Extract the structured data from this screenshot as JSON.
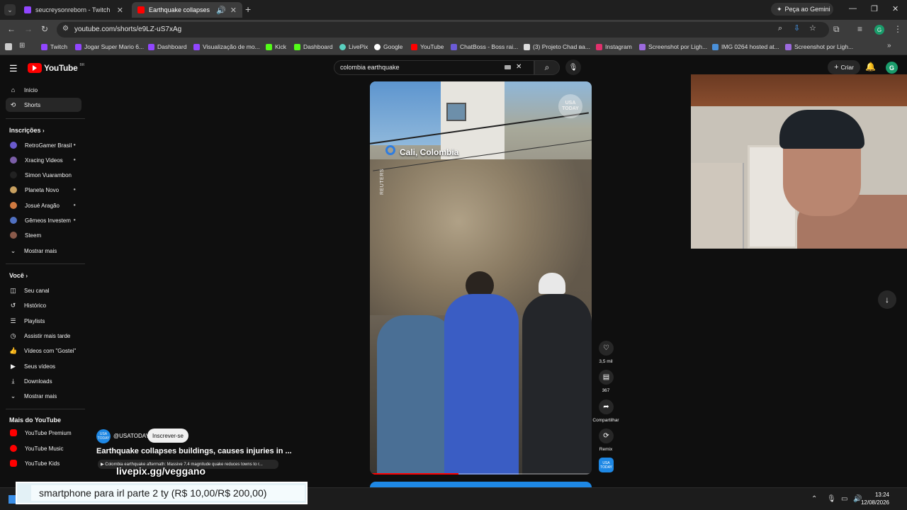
{
  "browser": {
    "tabs": [
      {
        "label": "seucreysonreborn - Twitch",
        "color": "#9146ff"
      },
      {
        "label": "Earthquake collapses buildi",
        "color": "#ff0000"
      }
    ],
    "gemini_label": "Peça ao Gemini",
    "url": "youtube.com/shorts/e9LZ-uS7xAg",
    "profile_initial": "G",
    "bookmarks": [
      {
        "label": "Twitch",
        "color": "#9146ff"
      },
      {
        "label": "Jogar Super Mario 6...",
        "color": "#9146ff"
      },
      {
        "label": "Dashboard",
        "color": "#9146ff"
      },
      {
        "label": "Visualização de mo...",
        "color": "#9146ff"
      },
      {
        "label": "Kick",
        "color": "#53fc18"
      },
      {
        "label": "Dashboard",
        "color": "#53fc18"
      },
      {
        "label": "LivePix",
        "color": "#5ad0c0"
      },
      {
        "label": "Google",
        "color": "#ffffff"
      },
      {
        "label": "YouTube",
        "color": "#ff0000"
      },
      {
        "label": "ChatBoss - Boss rai...",
        "color": "#6b5bd6"
      },
      {
        "label": "(3) Projeto Chad ва...",
        "color": "#dddddd"
      },
      {
        "label": "Instagram",
        "color": "#e1306c"
      },
      {
        "label": "Screenshot por Ligh...",
        "color": "#9c6ade"
      },
      {
        "label": "IMG 0264 hosted at...",
        "color": "#4a90d9"
      },
      {
        "label": "Screenshot por Ligh...",
        "color": "#9c6ade"
      }
    ]
  },
  "youtube": {
    "logo_text": "YouTube",
    "logo_region": "BR",
    "search_value": "colombia earthquake",
    "create_label": "Criar",
    "avatar_initial": "G",
    "sidebar": {
      "main": [
        {
          "label": "Início",
          "icon": "home-icon"
        },
        {
          "label": "Shorts",
          "icon": "shorts-icon"
        }
      ],
      "subscriptions_title": "Inscrições",
      "subscriptions": [
        {
          "label": "RetroGamer Brasil",
          "color": "#6a5acd"
        },
        {
          "label": "Xracing Videos",
          "color": "#7b5ea7"
        },
        {
          "label": "Simon Vuarambon",
          "color": "#222222"
        },
        {
          "label": "Planeta Novo",
          "color": "#c8a060"
        },
        {
          "label": "Josué Aragão",
          "color": "#d07a40"
        },
        {
          "label": "Gêmeos Investem",
          "color": "#5070c0"
        },
        {
          "label": "Steem",
          "color": "#8a5a4a"
        }
      ],
      "show_more": "Mostrar mais",
      "you_title": "Você",
      "you": [
        {
          "label": "Seu canal",
          "icon": "channel-icon"
        },
        {
          "label": "Histórico",
          "icon": "history-icon"
        },
        {
          "label": "Playlists",
          "icon": "playlists-icon"
        },
        {
          "label": "Assistir mais tarde",
          "icon": "watch-later-icon"
        },
        {
          "label": "Vídeos com \"Gostei\"",
          "icon": "like-icon"
        },
        {
          "label": "Seus vídeos",
          "icon": "your-videos-icon"
        },
        {
          "label": "Downloads",
          "icon": "download-icon"
        }
      ],
      "show_more_2": "Mostrar mais",
      "more_title": "Mais do YouTube",
      "more": [
        {
          "label": "YouTube Premium",
          "color": "#ff0000"
        },
        {
          "label": "YouTube Music",
          "color": "#ff0000"
        },
        {
          "label": "YouTube Kids",
          "color": "#ff0000"
        }
      ]
    },
    "short": {
      "location": "Cali, Colombia",
      "watermark": "USA TODAY",
      "credit": "REUTERS",
      "progress": 0.4,
      "likes": "3,5 mil",
      "comments": "367",
      "share_label": "Compartilhar",
      "remix_label": "Remix",
      "channel_handle": "@USATODAY",
      "subscribe_label": "Inscrever-se",
      "title": "Earthquake collapses buildings, causes injuries in ...",
      "related": "Colombia earthquake aftermath: Massive 7.4 magnitude quake reduces towns to r..."
    }
  },
  "overlay": {
    "livepix": "livepix.gg/veggano",
    "donation": "smartphone para irl parte 2 ty (R$ 10,00/R$ 200,00)"
  },
  "taskbar": {
    "time": "13:24",
    "date": "12/08/2026"
  }
}
